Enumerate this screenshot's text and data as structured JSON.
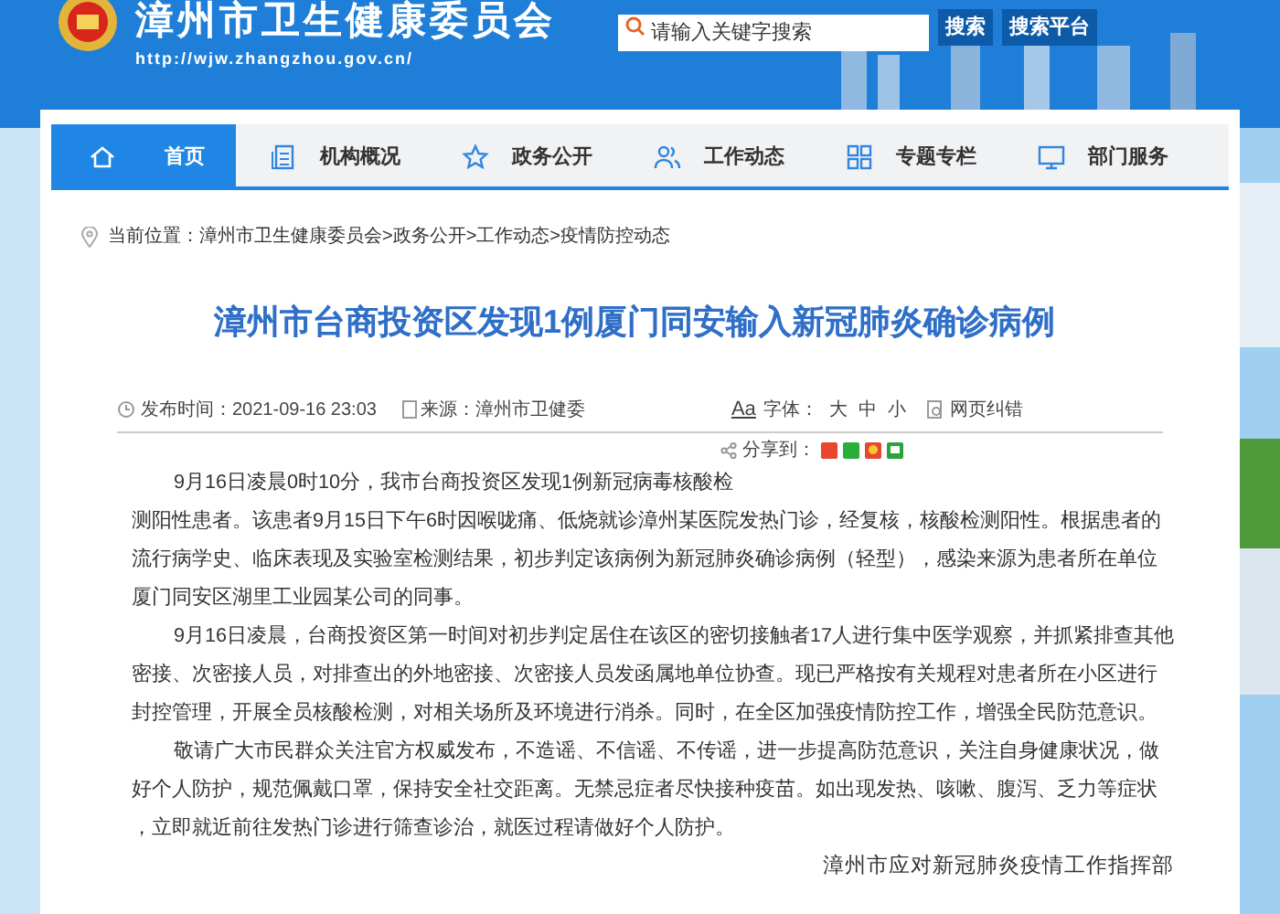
{
  "header": {
    "site_title": "漳州市卫生健康委员会",
    "url": "http://wjw.zhangzhou.gov.cn/",
    "search": {
      "placeholder": "请输入关键字搜索"
    },
    "buttons": [
      "搜索",
      "搜索平台"
    ]
  },
  "nav": [
    {
      "label": "首页",
      "selected": true
    },
    {
      "label": "机构概况",
      "selected": false
    },
    {
      "label": "政务公开",
      "selected": false
    },
    {
      "label": "工作动态",
      "selected": false
    },
    {
      "label": "专题专栏",
      "selected": false
    },
    {
      "label": "部门服务",
      "selected": false
    }
  ],
  "breadcrumb": {
    "label": "当前位置：",
    "path": "漳州市卫生健康委员会>政务公开>工作动态>疫情防控动态"
  },
  "article": {
    "title": "漳州市台商投资区发现1例厦门同安输入新冠肺炎确诊病例",
    "meta": {
      "published": "发布时间：2021-09-16 23:03",
      "source": "来源：漳州市卫健委",
      "font_icon": "Aa",
      "font_label": "字体：",
      "font_sizes": [
        "大",
        "中",
        "小"
      ],
      "correction": "网页纠错",
      "share": "分享到："
    },
    "paragraphs": [
      {
        "lines": [
          "9月16日凌晨0时10分，我市台商投资区发现1例新冠病毒核酸检",
          "测阳性患者。该患者9月15日下午6时因喉咙痛、低烧就诊漳州某医院发热门诊，经复核，核酸检测阳性。根据患者的",
          "流行病学史、临床表现及实验室检测结果，初步判定该病例为新冠肺炎确诊病例（轻型），感染来源为患者所在单位",
          "厦门同安区湖里工业园某公司的同事。"
        ]
      },
      {
        "lines": [
          "9月16日凌晨，台商投资区第一时间对初步判定居住在该区的密切接触者17人进行集中医学观察，并抓紧排查其他",
          "密接、次密接人员，对排查出的外地密接、次密接人员发函属地单位协查。现已严格按有关规程对患者所在小区进行",
          "封控管理，开展全员核酸检测，对相关场所及环境进行消杀。同时，在全区加强疫情防控工作，增强全民防范意识。"
        ]
      },
      {
        "lines": [
          "敬请广大市民群众关注官方权威发布，不造谣、不信谣、不传谣，进一步提高防范意识，关注自身健康状况，做",
          "好个人防护，规范佩戴口罩，保持安全社交距离。无禁忌症者尽快接种疫苗。如出现发热、咳嗽、腹泻、乏力等症状",
          "，立即就近前往发热门诊进行筛查诊治，就医过程请做好个人防护。"
        ]
      }
    ],
    "signature": "漳州市应对新冠肺炎疫情工作指挥部"
  }
}
